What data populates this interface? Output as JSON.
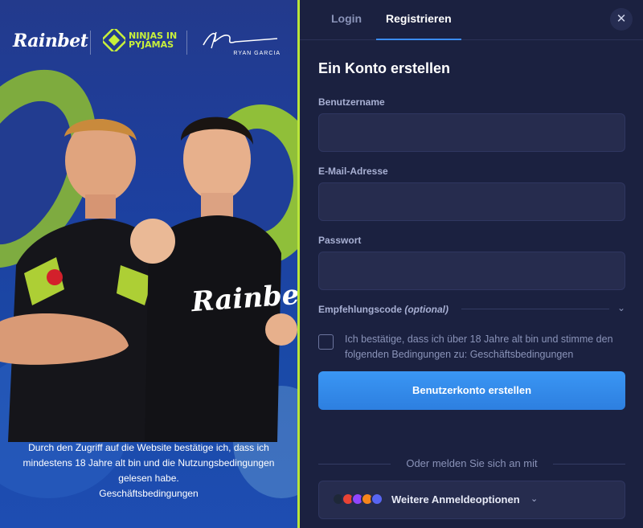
{
  "promo": {
    "brand_rainbet": "Rainbet",
    "brand_nip": "NINJAS IN PYJAMAS",
    "brand_ryan": "RYAN GARCIA",
    "shirt_text": "Rainbet",
    "disclaimer": "Durch den Zugriff auf die Website bestätige ich, dass ich mindestens 18 Jahre alt bin und die Nutzungsbedingungen gelesen habe.",
    "disclaimer_link": "Geschäftsbedingungen"
  },
  "tabs": [
    {
      "label": "Login",
      "active": false
    },
    {
      "label": "Registrieren",
      "active": true
    }
  ],
  "close_icon": "close-icon",
  "form": {
    "title": "Ein Konto erstellen",
    "username_label": "Benutzername",
    "username_value": "",
    "email_label": "E-Mail-Adresse",
    "email_value": "",
    "password_label": "Passwort",
    "password_value": "",
    "referral_label": "Empfehlungscode",
    "referral_optional": "(optional)",
    "terms_text": "Ich bestätige, dass ich über 18 Jahre alt bin und stimme den folgenden Bedingungen zu:",
    "terms_link": "Geschäftsbedingungen",
    "terms_checked": false,
    "submit_label": "Benutzerkonto erstellen",
    "divider_label": "Oder melden Sie sich an mit",
    "more_options_label": "Weitere Anmeldeoptionen"
  },
  "colors": {
    "panel_bg": "#1b2140",
    "input_bg": "#262c4e",
    "accent_blue": "#3b8cf3",
    "brand_green": "#b9e53a"
  }
}
